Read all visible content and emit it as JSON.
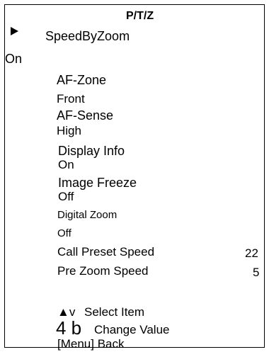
{
  "menu": {
    "title": "P/T/Z",
    "selected_item": "SpeedByZoom",
    "selected_value": "On",
    "items": [
      {
        "label": "AF-Zone",
        "value": "Front"
      },
      {
        "label": "AF-Sense",
        "value": "High"
      },
      {
        "label": "Display Info",
        "value": "On"
      },
      {
        "label": "Image Freeze",
        "value": "Off"
      },
      {
        "label": "Digital Zoom",
        "value": "Off"
      }
    ],
    "call_preset_speed": {
      "label": "Call Preset Speed",
      "value": "22"
    },
    "pre_zoom_speed": {
      "label": "Pre Zoom Speed",
      "value": "5"
    }
  },
  "help": {
    "select_keys": "▲v",
    "select_label": "Select Item",
    "change_keys": "4 b",
    "change_label": "Change Value",
    "back_label": "[Menu] Back"
  },
  "icons": {
    "cursor": "selection-arrow-icon"
  },
  "colors": {
    "background": "#ffffff",
    "text": "#000000",
    "border": "#000000"
  }
}
